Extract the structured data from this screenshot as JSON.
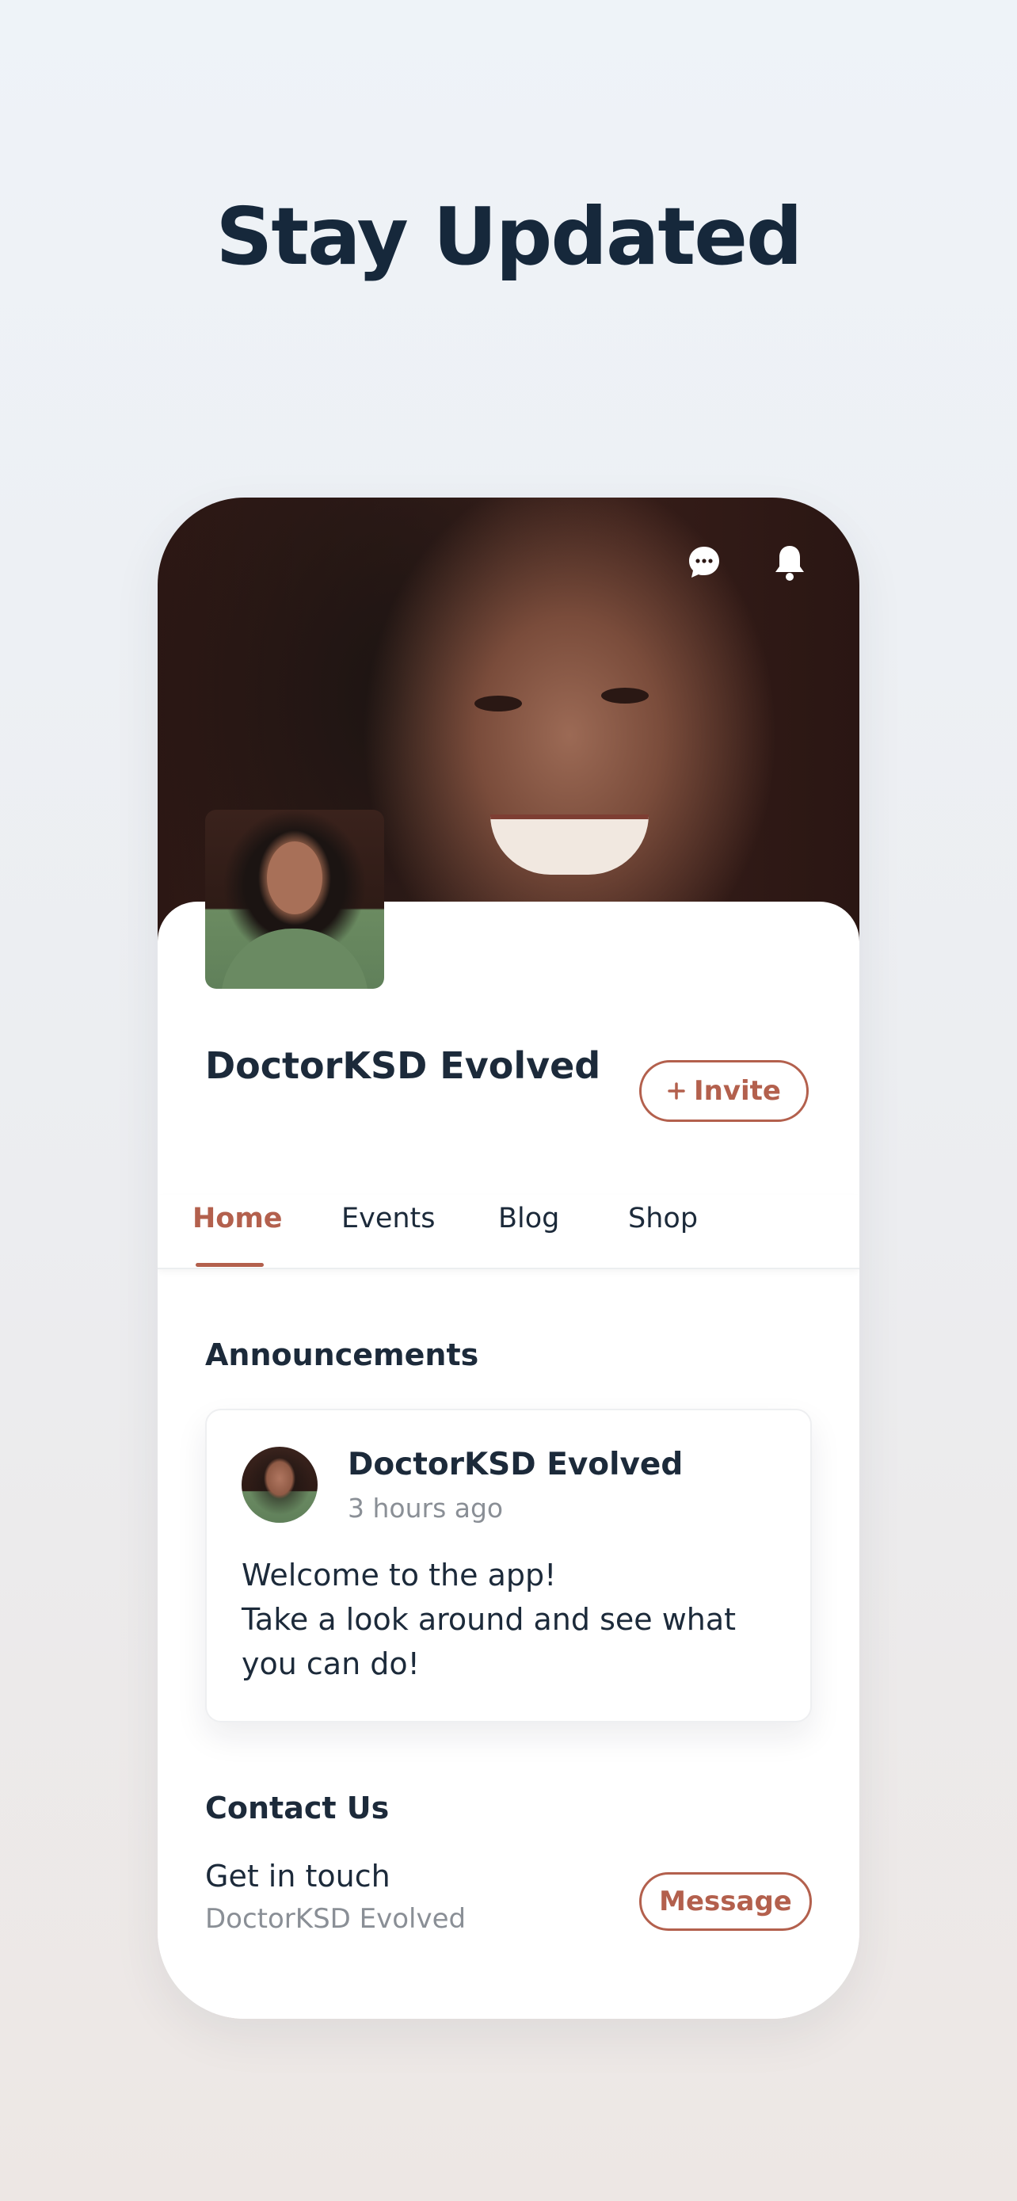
{
  "headline": "Stay Updated",
  "header": {
    "chat_icon": "chat-bubble-icon",
    "bell_icon": "bell-icon"
  },
  "profile": {
    "name": "DoctorKSD Evolved",
    "invite_label": "Invite",
    "invite_icon": "plus-icon"
  },
  "tabs": [
    {
      "label": "Home",
      "active": true
    },
    {
      "label": "Events",
      "active": false
    },
    {
      "label": "Blog",
      "active": false
    },
    {
      "label": "Shop",
      "active": false
    }
  ],
  "announcements": {
    "title": "Announcements",
    "post": {
      "author": "DoctorKSD Evolved",
      "time": "3 hours ago",
      "body_line1": "Welcome to the app!",
      "body_line2": "Take a look around and see what you can do!"
    }
  },
  "contact": {
    "title": "Contact Us",
    "line": "Get in touch",
    "sub": "DoctorKSD Evolved",
    "message_label": "Message"
  },
  "colors": {
    "accent": "#b3604d",
    "text": "#1c2a3a",
    "muted": "#8a8f96"
  }
}
